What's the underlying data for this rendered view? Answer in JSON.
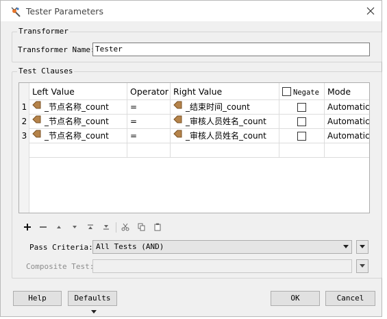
{
  "window": {
    "title": "Tester Parameters"
  },
  "transformer": {
    "group_label": "Transformer",
    "name_label": "Transformer Name:",
    "name_value": "Tester"
  },
  "clauses": {
    "group_label": "Test Clauses",
    "columns": {
      "left": "Left Value",
      "operator": "Operator",
      "right": "Right Value",
      "negate": "Negate",
      "mode": "Mode"
    },
    "rows": [
      {
        "num": "1",
        "left": "_节点名称_count",
        "operator": "=",
        "right": "_结束时间_count",
        "negate": false,
        "mode": "Automatic"
      },
      {
        "num": "2",
        "left": "_节点名称_count",
        "operator": "=",
        "right": "_审核人员姓名_count",
        "negate": false,
        "mode": "Automatic"
      },
      {
        "num": "3",
        "left": "_节点名称_count",
        "operator": "=",
        "right": "_审核人员姓名_count",
        "negate": false,
        "mode": "Automatic"
      }
    ],
    "toolbar_icons": [
      "plus-icon",
      "minus-icon",
      "move-up-icon",
      "move-down-icon",
      "move-top-icon",
      "move-bottom-icon",
      "cut-icon",
      "copy-icon",
      "paste-icon"
    ]
  },
  "criteria": {
    "pass_label": "Pass Criteria:",
    "pass_value": "All Tests (AND)",
    "composite_label": "Composite Test:",
    "composite_value": ""
  },
  "buttons": {
    "help": "Help",
    "defaults": "Defaults",
    "ok": "OK",
    "cancel": "Cancel"
  },
  "colors": {
    "attribute_icon": "#b5834a",
    "disabled_text": "#8c8c8c"
  }
}
